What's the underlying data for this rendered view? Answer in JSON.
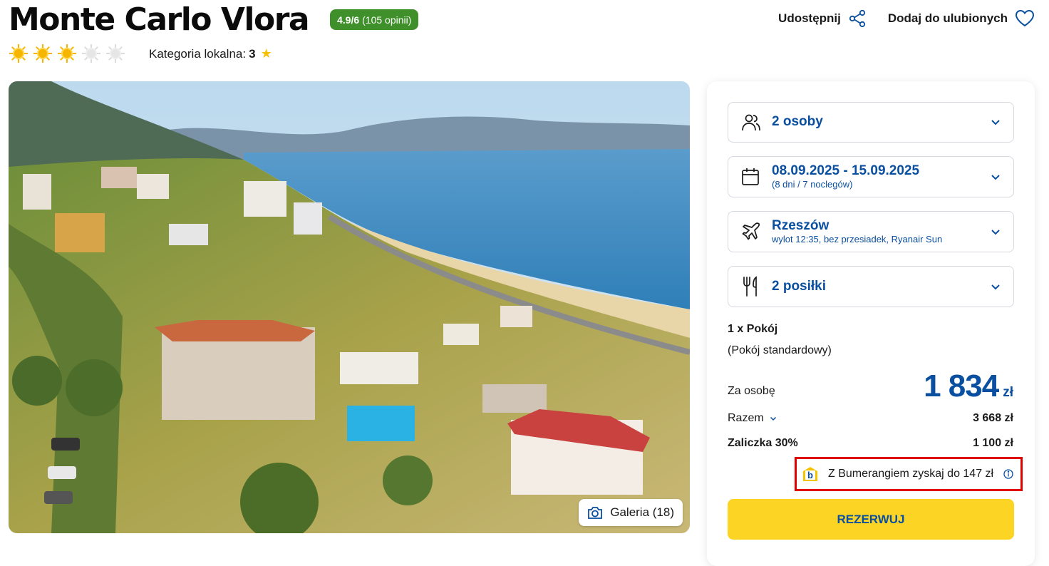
{
  "hotel": {
    "name": "Monte Carlo Vlora",
    "rating_score": "4.9/6",
    "rating_count": "(105 opinii)",
    "sun_rating": {
      "filled": 3,
      "total": 5
    },
    "local_category_label": "Kategoria lokalna:",
    "local_category_value": "3"
  },
  "header_actions": {
    "share_label": "Udostępnij",
    "favorite_label": "Dodaj do ulubionych"
  },
  "gallery": {
    "button_label": "Galeria (18)"
  },
  "booking": {
    "persons": "2 osoby",
    "dates": "08.09.2025 - 15.09.2025",
    "dates_sub": "(8 dni / 7 noclegów)",
    "departure": "Rzeszów",
    "departure_sub": "wylot 12:35, bez przesiadek, Ryanair Sun",
    "meals": "2 posiłki",
    "room_count": "1 x Pokój",
    "room_type": "(Pokój standardowy)",
    "per_person_label": "Za osobę",
    "per_person_value": "1 834",
    "currency": "zł",
    "total_label": "Razem",
    "total_value": "3 668 zł",
    "deposit_label": "Zaliczka 30%",
    "deposit_value": "1 100 zł",
    "bumerang_text": "Z Bumerangiem zyskaj do 147 zł",
    "reserve_label": "REZERWUJ"
  },
  "colors": {
    "brand_blue": "#0a4fa0",
    "rating_green": "#3f8f2a",
    "reserve_yellow": "#fcd423",
    "highlight_red": "#e00000"
  }
}
